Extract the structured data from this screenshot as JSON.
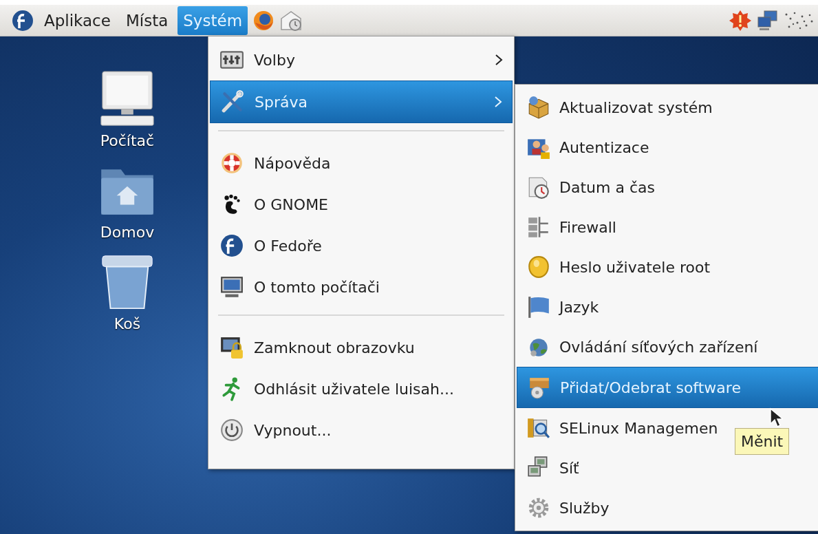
{
  "panel": {
    "menus": [
      {
        "label": "Aplikace",
        "selected": false
      },
      {
        "label": "Místa",
        "selected": false
      },
      {
        "label": "Systém",
        "selected": true
      }
    ]
  },
  "desktop_icons": [
    {
      "label": "Počítač"
    },
    {
      "label": "Domov"
    },
    {
      "label": "Koš"
    }
  ],
  "system_menu": {
    "items": [
      {
        "kind": "item",
        "label": "Volby",
        "has_submenu": true,
        "selected": false
      },
      {
        "kind": "item",
        "label": "Správa",
        "has_submenu": true,
        "selected": true
      },
      {
        "kind": "separator"
      },
      {
        "kind": "item",
        "label": "Nápověda",
        "has_submenu": false,
        "selected": false
      },
      {
        "kind": "item",
        "label": "O GNOME",
        "has_submenu": false,
        "selected": false
      },
      {
        "kind": "item",
        "label": "O Fedoře",
        "has_submenu": false,
        "selected": false
      },
      {
        "kind": "item",
        "label": "O tomto počítači",
        "has_submenu": false,
        "selected": false
      },
      {
        "kind": "separator"
      },
      {
        "kind": "item",
        "label": "Zamknout obrazovku",
        "has_submenu": false,
        "selected": false
      },
      {
        "kind": "item",
        "label": "Odhlásit uživatele luisah...",
        "has_submenu": false,
        "selected": false
      },
      {
        "kind": "item",
        "label": "Vypnout...",
        "has_submenu": false,
        "selected": false
      }
    ]
  },
  "admin_submenu": {
    "items": [
      {
        "label": "Aktualizovat systém",
        "selected": false
      },
      {
        "label": "Autentizace",
        "selected": false
      },
      {
        "label": "Datum a čas",
        "selected": false
      },
      {
        "label": "Firewall",
        "selected": false
      },
      {
        "label": "Heslo uživatele root",
        "selected": false
      },
      {
        "label": "Jazyk",
        "selected": false
      },
      {
        "label": "Ovládání síťových zařízení",
        "selected": false
      },
      {
        "label": "Přidat/Odebrat software",
        "selected": true
      },
      {
        "label": "SELinux Managemen",
        "selected": false
      },
      {
        "label": "Síť",
        "selected": false
      },
      {
        "label": "Služby",
        "selected": false
      }
    ]
  },
  "tooltip": {
    "text": "Měnit"
  }
}
